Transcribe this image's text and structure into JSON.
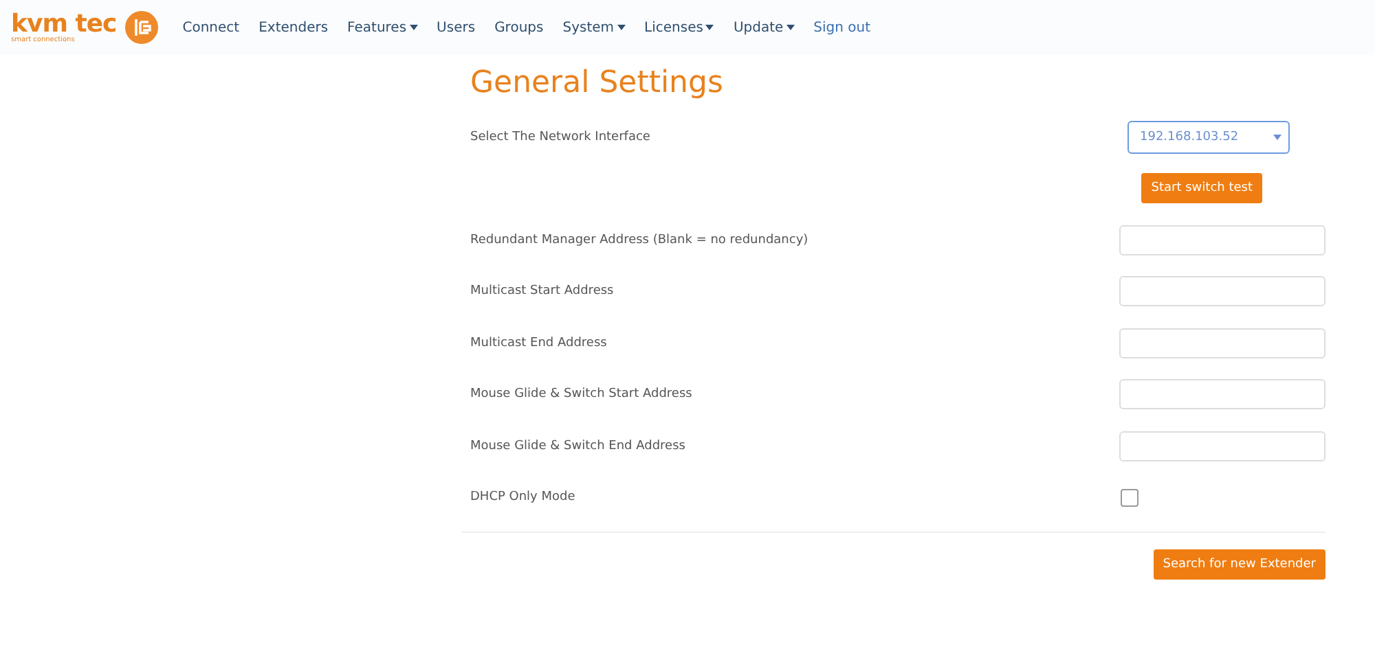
{
  "brand": {
    "name": "kvm tec",
    "tagline": "smart connections"
  },
  "nav": [
    {
      "label": "Connect",
      "kind": "link"
    },
    {
      "label": "Extenders",
      "kind": "link"
    },
    {
      "label": "Features",
      "kind": "dropdown"
    },
    {
      "label": "Users",
      "kind": "link"
    },
    {
      "label": "Groups",
      "kind": "link"
    },
    {
      "label": "System",
      "kind": "dropdown"
    },
    {
      "label": "Licenses",
      "kind": "dropdown"
    },
    {
      "label": "Update",
      "kind": "dropdown"
    },
    {
      "label": "Sign out",
      "kind": "accent"
    }
  ],
  "title": "General Settings",
  "rows": [
    {
      "kind": "select",
      "label": "Select The Network Interface",
      "value": "192.168.103.52"
    },
    {
      "kind": "button",
      "label_button": "Start switch test"
    },
    {
      "kind": "text",
      "label": "Redundant Manager Address (Blank = no redundancy)"
    },
    {
      "kind": "text",
      "label": "Multicast Start Address"
    },
    {
      "kind": "text",
      "label": "Multicast End Address"
    },
    {
      "kind": "text",
      "label": "Mouse Glide & Switch Start Address"
    },
    {
      "kind": "text",
      "label": "Mouse Glide & Switch End Address"
    },
    {
      "kind": "checkbox",
      "label": "DHCP Only Mode",
      "checked": false
    }
  ],
  "footer_button": "Search for new Extender"
}
